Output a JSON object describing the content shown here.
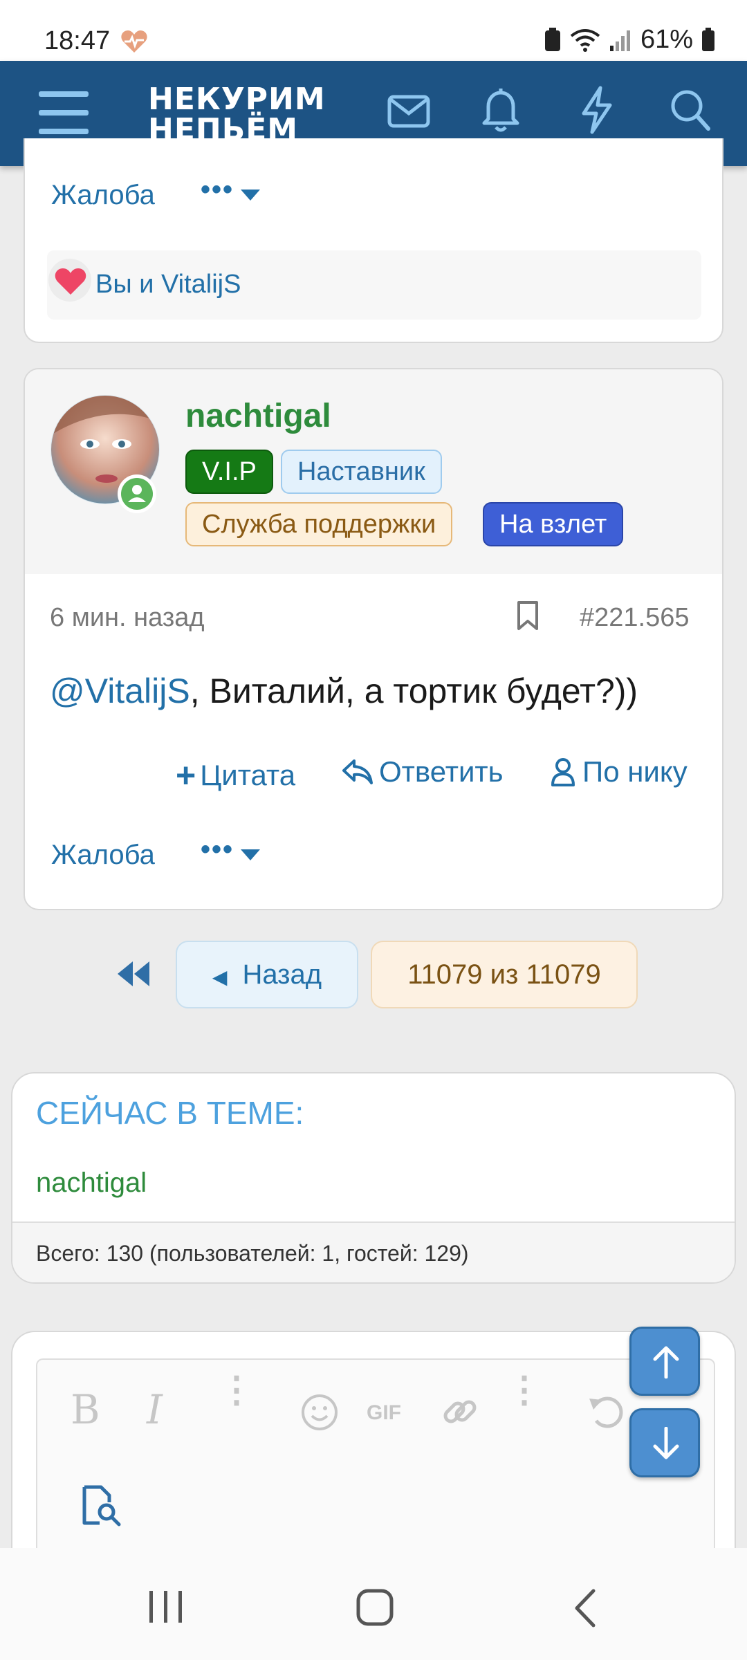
{
  "status": {
    "time": "18:47",
    "battery": "61%"
  },
  "header": {
    "logo_line1": "НЕКУРИМ",
    "logo_line2": "НЕПЬЁМ"
  },
  "prev_post": {
    "report_label": "Жалоба",
    "likes_text": "Вы и VitalijS"
  },
  "post": {
    "username": "nachtigal",
    "badges": [
      "V.I.P",
      "Наставник",
      "Служба поддержки",
      "На взлет"
    ],
    "time": "6 мин. назад",
    "number": "#221.565",
    "mention": "@VitalijS",
    "text": ", Виталий, а тортик будет?))",
    "actions": {
      "quote": "Цитата",
      "reply": "Ответить",
      "by_nick": "По нику"
    },
    "report_label": "Жалоба"
  },
  "pagination": {
    "back_label": "Назад",
    "page_info": "11079 из 11079"
  },
  "now_in_topic": {
    "title": "СЕЙЧАС В ТЕМЕ:",
    "users": [
      "nachtigal"
    ],
    "totals": "Всего: 130 (пользователей: 1, гостей: 129)"
  },
  "colors": {
    "header": "#1d5384",
    "vip": "#157a15",
    "username": "#2e8b3c",
    "link": "#2270a8",
    "takeoff": "#3e5fd6"
  }
}
